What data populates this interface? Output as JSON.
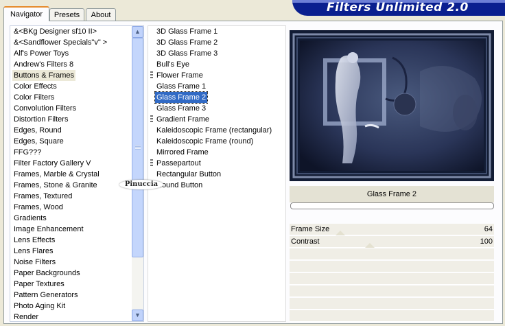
{
  "tabs": [
    {
      "label": "Navigator"
    },
    {
      "label": "Presets"
    },
    {
      "label": "About"
    }
  ],
  "banner_title": "Filters Unlimited 2.0",
  "categories": [
    {
      "label": "&<BKg Designer sf10 II>"
    },
    {
      "label": "&<Sandflower Specials\"v\" >"
    },
    {
      "label": "Alf's Power Toys"
    },
    {
      "label": "Andrew's Filters 8"
    },
    {
      "label": "Buttons & Frames"
    },
    {
      "label": "Color Effects"
    },
    {
      "label": "Color Filters"
    },
    {
      "label": "Convolution Filters"
    },
    {
      "label": "Distortion Filters"
    },
    {
      "label": "Edges, Round"
    },
    {
      "label": "Edges, Square"
    },
    {
      "label": "FFG???"
    },
    {
      "label": "Filter Factory Gallery V"
    },
    {
      "label": "Frames, Marble & Crystal"
    },
    {
      "label": "Frames, Stone & Granite"
    },
    {
      "label": "Frames, Textured"
    },
    {
      "label": "Frames, Wood"
    },
    {
      "label": "Gradients"
    },
    {
      "label": "Image Enhancement"
    },
    {
      "label": "Lens Effects"
    },
    {
      "label": "Lens Flares"
    },
    {
      "label": "Noise Filters"
    },
    {
      "label": "Paper Backgrounds"
    },
    {
      "label": "Paper Textures"
    },
    {
      "label": "Pattern Generators"
    },
    {
      "label": "Photo Aging Kit"
    },
    {
      "label": "Render"
    }
  ],
  "selected_category": "Buttons & Frames",
  "filters": [
    {
      "label": "3D Glass Frame 1"
    },
    {
      "label": "3D Glass Frame 2"
    },
    {
      "label": "3D Glass Frame 3"
    },
    {
      "label": "Bull's Eye"
    },
    {
      "label": "Flower Frame"
    },
    {
      "label": "Glass Frame 1"
    },
    {
      "label": "Glass Frame 2"
    },
    {
      "label": "Glass Frame 3"
    },
    {
      "label": "Gradient Frame"
    },
    {
      "label": "Kaleidoscopic Frame (rectangular)"
    },
    {
      "label": "Kaleidoscopic Frame (round)"
    },
    {
      "label": "Mirrored Frame"
    },
    {
      "label": "Passepartout"
    },
    {
      "label": "Rectangular Button"
    },
    {
      "label": "Round Button"
    }
  ],
  "selected_filter": "Glass Frame 2",
  "filter_name": "Glass Frame 2",
  "params": [
    {
      "label": "Frame Size",
      "value": "64"
    },
    {
      "label": "Contrast",
      "value": "100"
    }
  ],
  "watermark_text": "Pinuccia",
  "scrollbar_icons": {
    "up": "chevron-up-icon",
    "down": "chevron-down-icon"
  },
  "colors": {
    "selection": "#316ac5",
    "banner": "#0a1f8f",
    "tab_accent": "#e68b2c"
  }
}
